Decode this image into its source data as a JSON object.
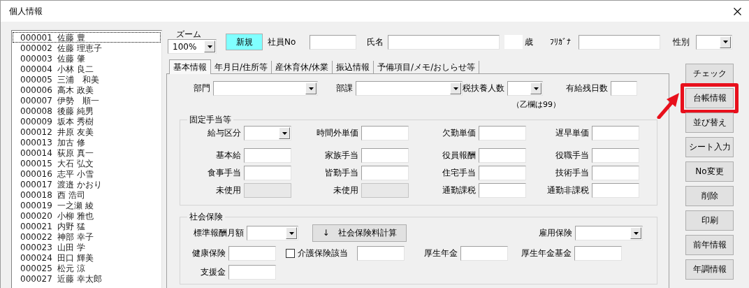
{
  "window": {
    "title": "個人情報"
  },
  "employees": [
    {
      "number": "000001",
      "name": "佐藤 豊",
      "focused": true
    },
    {
      "number": "000002",
      "name": "佐藤 理恵子",
      "focused": false
    },
    {
      "number": "000003",
      "name": "佐藤 肇",
      "focused": false
    },
    {
      "number": "000004",
      "name": "小林 良二",
      "focused": false
    },
    {
      "number": "000005",
      "name": "三浦　和美",
      "focused": false
    },
    {
      "number": "000006",
      "name": "高木 政美",
      "focused": false
    },
    {
      "number": "000007",
      "name": "伊勢　順一",
      "focused": false
    },
    {
      "number": "000008",
      "name": "後藤 純男",
      "focused": false
    },
    {
      "number": "000009",
      "name": "坂本 秀樹",
      "focused": false
    },
    {
      "number": "000012",
      "name": "井原 友美",
      "focused": false
    },
    {
      "number": "000013",
      "name": "加古 修",
      "focused": false
    },
    {
      "number": "000014",
      "name": "荻原 真一",
      "focused": false
    },
    {
      "number": "000015",
      "name": "大石 弘文",
      "focused": false
    },
    {
      "number": "000016",
      "name": "志平 小雪",
      "focused": false
    },
    {
      "number": "000017",
      "name": "渡邉 かおり",
      "focused": false
    },
    {
      "number": "000018",
      "name": "西 浩司",
      "focused": false
    },
    {
      "number": "000019",
      "name": "一之瀬 綾",
      "focused": false
    },
    {
      "number": "000020",
      "name": "小柳 雅也",
      "focused": false
    },
    {
      "number": "000021",
      "name": "内野 猛",
      "focused": false
    },
    {
      "number": "000022",
      "name": "神部 幸子",
      "focused": false
    },
    {
      "number": "000023",
      "name": "山田 学",
      "focused": false
    },
    {
      "number": "000024",
      "name": "田口 輝美",
      "focused": false
    },
    {
      "number": "000025",
      "name": "松元 涼",
      "focused": false
    },
    {
      "number": "000027",
      "name": "近藤 幸太郎",
      "focused": false
    }
  ],
  "header": {
    "zoom": {
      "label": "ズーム",
      "value": "100%"
    },
    "new_button": "新規",
    "fields": [
      {
        "label": "社員No",
        "kind": "text"
      },
      {
        "label": "氏名",
        "kind": "text"
      },
      {
        "label": "歳",
        "kind": "age"
      },
      {
        "label": "ﾌﾘｶﾞﾅ",
        "kind": "text"
      },
      {
        "label": "性別",
        "kind": "combo"
      }
    ]
  },
  "tabs": [
    {
      "label": "基本情報",
      "selected": true
    },
    {
      "label": "年月日/住所等",
      "selected": false
    },
    {
      "label": "産休育休/休業",
      "selected": false
    },
    {
      "label": "振込情報",
      "selected": false
    },
    {
      "label": "予備項目/メモ/おしらせ等",
      "selected": false
    }
  ],
  "basic": {
    "fields": [
      {
        "label": "部門",
        "kind": "combo"
      },
      {
        "label": "部課",
        "kind": "combo"
      },
      {
        "label": "税扶養人数",
        "kind": "combo"
      },
      {
        "label": "有給残日数",
        "kind": "text"
      }
    ],
    "note": "（乙欄は99）"
  },
  "allowances": {
    "title": "固定手当等",
    "fields": [
      {
        "label": "給与区分",
        "kind": "combo",
        "disabled": false
      },
      {
        "label": "時間外単価",
        "kind": "text",
        "disabled": false
      },
      {
        "label": "欠勤単価",
        "kind": "text",
        "disabled": false
      },
      {
        "label": "遅早単価",
        "kind": "text",
        "disabled": false
      },
      {
        "label": "基本給",
        "kind": "text",
        "disabled": false
      },
      {
        "label": "家族手当",
        "kind": "text",
        "disabled": false
      },
      {
        "label": "役員報酬",
        "kind": "text",
        "disabled": false
      },
      {
        "label": "役職手当",
        "kind": "text",
        "disabled": false
      },
      {
        "label": "食事手当",
        "kind": "text",
        "disabled": false
      },
      {
        "label": "皆勤手当",
        "kind": "text",
        "disabled": false
      },
      {
        "label": "住宅手当",
        "kind": "text",
        "disabled": false
      },
      {
        "label": "技術手当",
        "kind": "text",
        "disabled": false
      },
      {
        "label": "未使用",
        "kind": "text",
        "disabled": true
      },
      {
        "label": "未使用",
        "kind": "text",
        "disabled": true
      },
      {
        "label": "通勤課税",
        "kind": "text",
        "disabled": false
      },
      {
        "label": "通勤非課税",
        "kind": "text",
        "disabled": false
      }
    ]
  },
  "social": {
    "title": "社会保険",
    "rows": [
      [
        {
          "label": "標準報酬月額",
          "kind": "combo"
        },
        {
          "label": "↓　社会保険料計算",
          "kind": "button"
        },
        {
          "label": "雇用保険",
          "kind": "combo"
        }
      ],
      [
        {
          "label": "健康保険",
          "kind": "text"
        },
        {
          "label": "介護保険該当",
          "kind": "checkbox",
          "checked": false
        },
        {
          "kind": "text"
        },
        {
          "label": "厚生年金",
          "kind": "text"
        },
        {
          "label": "厚生年金基金",
          "kind": "text"
        }
      ],
      [
        {
          "label": "支援金",
          "kind": "text"
        }
      ]
    ]
  },
  "side_buttons": [
    {
      "label": "チェック",
      "highlighted": false
    },
    {
      "label": "台帳情報",
      "highlighted": true
    },
    {
      "label": "並び替え",
      "highlighted": false
    },
    {
      "label": "シート入力",
      "highlighted": false
    },
    {
      "label": "No変更",
      "highlighted": false
    },
    {
      "label": "削除",
      "highlighted": false
    },
    {
      "label": "印刷",
      "highlighted": false
    },
    {
      "label": "前年情報",
      "highlighted": false
    },
    {
      "label": "年調情報",
      "highlighted": false
    }
  ]
}
